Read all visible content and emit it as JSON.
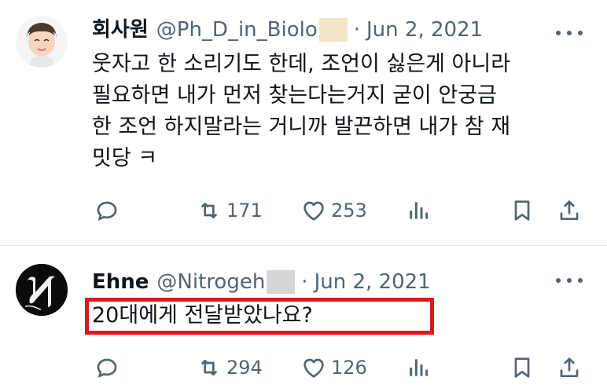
{
  "tweets": [
    {
      "name": "회사원",
      "handle": "@Ph_D_in_Biolo",
      "separator": "·",
      "date": "Jun 2, 2021",
      "text": "웃자고 한 소리기도 한데, 조언이 싫은게 아니라\n필요하면 내가 먼저 찾는다는거지 굳이 안궁금\n한 조언 하지말라는 거니까 발끈하면 내가 참 재\n밋당 ㅋ",
      "retweets": "171",
      "likes": "253",
      "avatar_icon": "cartoon-person-avatar-icon"
    },
    {
      "name": "Ehne",
      "handle": "@Nitrogeh",
      "separator": "·",
      "date": "Jun 2, 2021",
      "text": "20대에게 전달받았나요?",
      "retweets": "294",
      "likes": "126",
      "avatar_icon": "gothic-letter-n-avatar-icon"
    }
  ],
  "colors": {
    "text": "#0f1419",
    "secondary": "#536471",
    "highlight_border": "#e0161d",
    "divider": "#e6e9ec"
  },
  "icons": [
    "more-icon",
    "reply-icon",
    "retweet-icon",
    "like-icon",
    "views-icon",
    "bookmark-icon",
    "share-icon"
  ]
}
